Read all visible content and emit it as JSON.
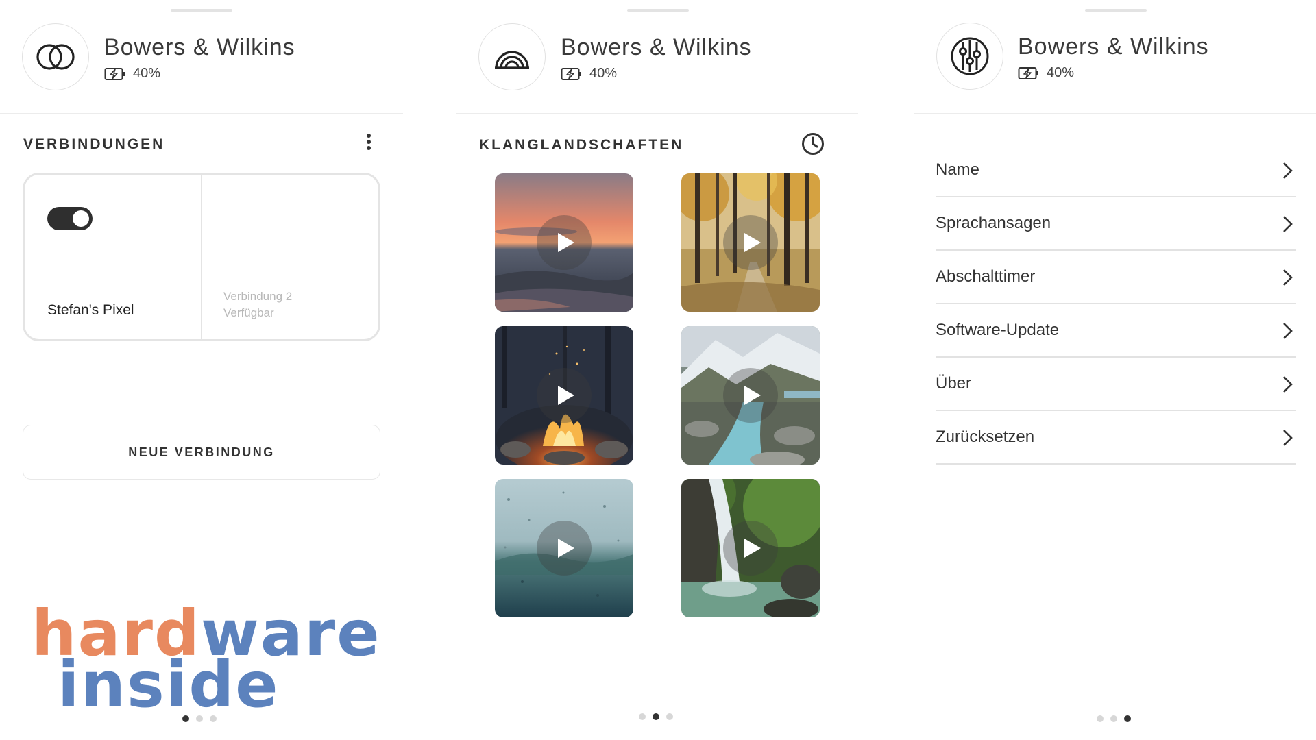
{
  "device": {
    "brand": "Bowers & Wilkins",
    "battery": "40%"
  },
  "connections": {
    "title": "VERBINDUNGEN",
    "more_icon": "more-vertical-icon",
    "active_device": "Stefan's Pixel",
    "slot2_name": "Verbindung 2",
    "slot2_status": "Verfügbar",
    "new_button": "NEUE VERBINDUNG",
    "page_dots": {
      "count": 3,
      "active": 1
    }
  },
  "soundscapes": {
    "title": "KLANGLANDSCHAFTEN",
    "history_icon": "clock-icon",
    "tiles": [
      {
        "scene": "sunset-sea"
      },
      {
        "scene": "autumn-forest"
      },
      {
        "scene": "campfire"
      },
      {
        "scene": "mountain-river"
      },
      {
        "scene": "rain-window"
      },
      {
        "scene": "waterfall"
      }
    ],
    "page_dots": {
      "count": 3,
      "active": 2
    }
  },
  "settings": {
    "items": [
      "Name",
      "Sprachansagen",
      "Abschalttimer",
      "Software-Update",
      "Über",
      "Zurücksetzen"
    ],
    "page_dots": {
      "count": 3,
      "active": 3
    }
  },
  "watermark": {
    "line1_part1": "hard",
    "line1_part2": "ware",
    "line2": "inside",
    "colors": {
      "orange": "#e8895f",
      "blue": "#5c82bd"
    }
  }
}
